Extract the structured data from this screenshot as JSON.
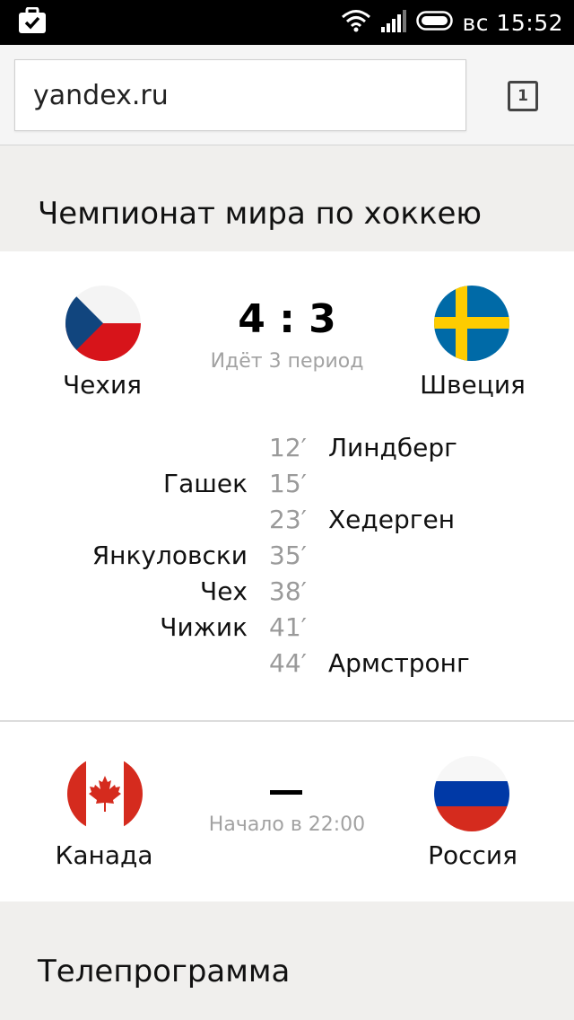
{
  "status_bar": {
    "day": "вс",
    "time": "15:52",
    "icons": [
      "clipboard-check-icon",
      "wifi-icon",
      "signal-icon",
      "battery-icon"
    ]
  },
  "browser": {
    "url": "yandex.ru",
    "tab_count": "1"
  },
  "section1": {
    "title": "Чемпионат мира по хоккею"
  },
  "match1": {
    "home": "Чехия",
    "away": "Швеция",
    "score": "4 : 3",
    "status": "Идёт 3 период",
    "goals": [
      {
        "minute": "12′",
        "home": "",
        "away": "Линдберг"
      },
      {
        "minute": "15′",
        "home": "Гашек",
        "away": ""
      },
      {
        "minute": "23′",
        "home": "",
        "away": "Хедерген"
      },
      {
        "minute": "35′",
        "home": "Янкуловски",
        "away": ""
      },
      {
        "minute": "38′",
        "home": "Чех",
        "away": ""
      },
      {
        "minute": "41′",
        "home": "Чижик",
        "away": ""
      },
      {
        "minute": "44′",
        "home": "",
        "away": "Армстронг"
      }
    ]
  },
  "match2": {
    "home": "Канада",
    "away": "Россия",
    "status": "Начало в 22:00"
  },
  "section2": {
    "title": "Телепрограмма"
  },
  "colors": {
    "czech_blue": "#11457e",
    "czech_red": "#d7141a",
    "sweden_blue": "#006aa7",
    "sweden_yellow": "#fecc00",
    "canada_red": "#d52b1e",
    "russia_blue": "#0039a6",
    "russia_red": "#d52b1e"
  }
}
